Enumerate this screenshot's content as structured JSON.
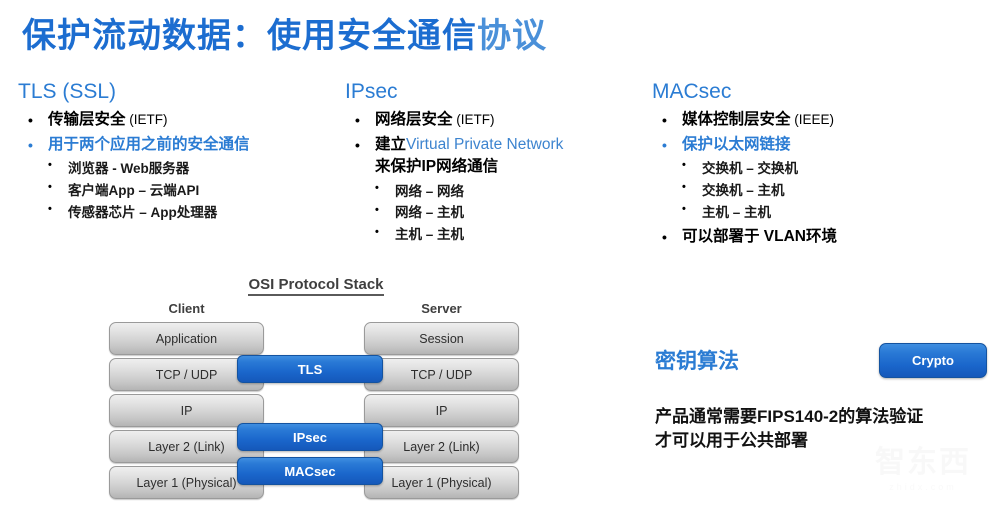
{
  "title": {
    "main": "保护流动数据：使用安全通信",
    "tail": "协议",
    "accent_color": "#1c6dd0"
  },
  "columns": [
    {
      "key": "tls",
      "heading": "TLS (SSL)",
      "items": [
        {
          "bullet": "•",
          "text": "传输层安全",
          "suffix": " (IETF)",
          "accent": false
        },
        {
          "bullet": "•",
          "text": "用于两个应用之前的安全通信",
          "suffix": "",
          "accent": true
        }
      ],
      "subitems": [
        {
          "bullet": "•",
          "text": "浏览器 - Web服务器"
        },
        {
          "bullet": "•",
          "text": "客户端App – 云端API"
        },
        {
          "bullet": "•",
          "text": "传感器芯片 – App处理器"
        }
      ]
    },
    {
      "key": "ipsec",
      "heading": "IPsec",
      "items": [
        {
          "bullet": "•",
          "text": "网络层安全",
          "suffix": " (IETF)",
          "accent": false
        }
      ],
      "vpn_line_prefix": "建立",
      "vpn_line_blue": "Virtual Private Network",
      "vpn_line_second": "来保护IP网络通信",
      "subitems": [
        {
          "bullet": "•",
          "text": "网络 – 网络"
        },
        {
          "bullet": "•",
          "text": "网络 – 主机"
        },
        {
          "bullet": "•",
          "text": "主机 – 主机"
        }
      ]
    },
    {
      "key": "macsec",
      "heading": "MACsec",
      "items": [
        {
          "bullet": "•",
          "text": "媒体控制层安全",
          "suffix": " (IEEE)",
          "accent": false
        },
        {
          "bullet": "•",
          "text": "保护以太网链接",
          "suffix": "",
          "accent": true
        }
      ],
      "subitems": [
        {
          "bullet": "•",
          "text": "交换机 – 交换机"
        },
        {
          "bullet": "•",
          "text": "交换机 – 主机"
        },
        {
          "bullet": "•",
          "text": "主机 – 主机"
        }
      ],
      "trailing_item": {
        "bullet": "•",
        "text": "可以部署于 VLAN环境"
      }
    }
  ],
  "osi": {
    "title": "OSI  Protocol Stack",
    "client_label": "Client",
    "server_label": "Server",
    "client_layers": [
      "Application",
      "TCP / UDP",
      "IP",
      "Layer 2 (Link)",
      "Layer 1 (Physical)"
    ],
    "server_layers": [
      "Session",
      "TCP / UDP",
      "IP",
      "Layer 2 (Link)",
      "Layer 1 (Physical)"
    ],
    "protocol_bars": [
      {
        "label": "TLS"
      },
      {
        "label": "IPsec"
      },
      {
        "label": "MACsec"
      }
    ],
    "bar_color": "#1a66cb",
    "box_color": "#d2d2d2"
  },
  "crypto": {
    "heading": "密钥算法",
    "button_label": "Crypto",
    "note_line1": "产品通常需要FIPS140-2的算法验证",
    "note_line2": "才可以用于公共部署"
  },
  "watermark": {
    "text": "智东西",
    "sub": "zhidx.com"
  }
}
